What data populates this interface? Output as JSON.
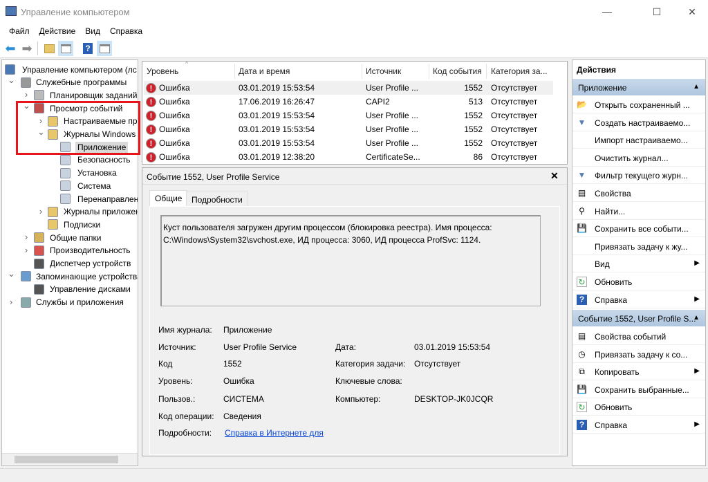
{
  "window": {
    "title": "Управление компьютером",
    "minimize": "—",
    "maximize": "☐",
    "close": "✕"
  },
  "menu": [
    "Файл",
    "Действие",
    "Вид",
    "Справка"
  ],
  "colors": {
    "accent": "#0078d7",
    "highlight": "#e8141b",
    "error": "#d0202a",
    "section": "#b8cde2",
    "link": "#0645d6"
  },
  "tree": [
    {
      "label": "Управление компьютером (лс",
      "level": 0,
      "exp": "",
      "icon": "computer-icon",
      "color": "#4a78b5"
    },
    {
      "label": "Служебные программы",
      "level": 1,
      "exp": "v",
      "icon": "tools-icon",
      "color": "#999"
    },
    {
      "label": "Планировщик заданий",
      "level": 2,
      "exp": ">",
      "icon": "clock-icon",
      "color": "#bbb"
    },
    {
      "label": "Просмотр событий",
      "level": 2,
      "exp": "v",
      "icon": "event-viewer-icon",
      "color": "#c0504d"
    },
    {
      "label": "Настраиваемые пре",
      "level": 3,
      "exp": ">",
      "icon": "filter-folder-icon",
      "color": "#e8c76b"
    },
    {
      "label": "Журналы Windows",
      "level": 3,
      "exp": "v",
      "icon": "folder-icon",
      "color": "#e8c76b"
    },
    {
      "label": "Приложение",
      "level": 4,
      "exp": "",
      "icon": "log-icon",
      "color": "#c9d3e0",
      "selected": true
    },
    {
      "label": "Безопасность",
      "level": 4,
      "exp": "",
      "icon": "log-icon",
      "color": "#c9d3e0"
    },
    {
      "label": "Установка",
      "level": 4,
      "exp": "",
      "icon": "log-icon",
      "color": "#c9d3e0"
    },
    {
      "label": "Система",
      "level": 4,
      "exp": "",
      "icon": "log-icon",
      "color": "#c9d3e0"
    },
    {
      "label": "Перенаправлен",
      "level": 4,
      "exp": "",
      "icon": "log-icon",
      "color": "#c9d3e0"
    },
    {
      "label": "Журналы приложен",
      "level": 3,
      "exp": ">",
      "icon": "folder-icon",
      "color": "#e8c76b"
    },
    {
      "label": "Подписки",
      "level": 3,
      "exp": "",
      "icon": "subscriptions-icon",
      "color": "#e8c76b"
    },
    {
      "label": "Общие папки",
      "level": 2,
      "exp": ">",
      "icon": "shared-folder-icon",
      "color": "#d6b35a"
    },
    {
      "label": "Производительность",
      "level": 2,
      "exp": ">",
      "icon": "performance-icon",
      "color": "#d9534f"
    },
    {
      "label": "Диспетчер устройств",
      "level": 2,
      "exp": "",
      "icon": "device-manager-icon",
      "color": "#555"
    },
    {
      "label": "Запоминающие устройства",
      "level": 1,
      "exp": "v",
      "icon": "storage-icon",
      "color": "#6a9ccf"
    },
    {
      "label": "Управление дисками",
      "level": 2,
      "exp": "",
      "icon": "disk-icon",
      "color": "#555"
    },
    {
      "label": "Службы и приложения",
      "level": 1,
      "exp": ">",
      "icon": "services-icon",
      "color": "#8aa"
    }
  ],
  "events": {
    "columns": [
      "Уровень",
      "Дата и время",
      "Источник",
      "Код события",
      "Категория за..."
    ],
    "rows": [
      [
        "Ошибка",
        "03.01.2019 15:53:54",
        "User Profile ...",
        "1552",
        "Отсутствует"
      ],
      [
        "Ошибка",
        "17.06.2019 16:26:47",
        "CAPI2",
        "513",
        "Отсутствует"
      ],
      [
        "Ошибка",
        "03.01.2019 15:53:54",
        "User Profile ...",
        "1552",
        "Отсутствует"
      ],
      [
        "Ошибка",
        "03.01.2019 15:53:54",
        "User Profile ...",
        "1552",
        "Отсутствует"
      ],
      [
        "Ошибка",
        "03.01.2019 15:53:54",
        "User Profile ...",
        "1552",
        "Отсутствует"
      ],
      [
        "Ошибка",
        "03.01.2019 12:38:20",
        "CertificateSe...",
        "86",
        "Отсутствует"
      ]
    ]
  },
  "detail": {
    "title": "Событие 1552, User Profile Service",
    "tabs": [
      "Общие",
      "Подробности"
    ],
    "description": "Куст пользователя загружен другим процессом (блокировка реестра). Имя процесса: C:\\Windows\\System32\\svchost.exe, ИД процесса: 3060, ИД процесса ProfSvc: 1124.",
    "fields": {
      "log_label": "Имя журнала:",
      "log": "Приложение",
      "source_label": "Источник:",
      "source": "User Profile Service",
      "date_label": "Дата:",
      "date": "03.01.2019 15:53:54",
      "code_label": "Код",
      "code": "1552",
      "category_label": "Категория задачи:",
      "category": "Отсутствует",
      "level_label": "Уровень:",
      "level": "Ошибка",
      "keywords_label": "Ключевые слова:",
      "user_label": "Пользов.:",
      "user": "СИСТЕМА",
      "computer_label": "Компьютер:",
      "computer": "DESKTOP-JK0JCQR",
      "opcode_label": "Код операции:",
      "opcode": "Сведения",
      "more_label": "Подробности:",
      "more_link": "Справка в Интернете для"
    }
  },
  "actions": {
    "title": "Действия",
    "section1": "Приложение",
    "items1": [
      {
        "label": "Открыть сохраненный ...",
        "icon": "open-folder-icon",
        "glyph": "📂"
      },
      {
        "label": "Создать настраиваемо...",
        "icon": "filter-icon",
        "glyph": "▼"
      },
      {
        "label": "Импорт настраиваемо...",
        "icon": "",
        "glyph": ""
      },
      {
        "label": "Очистить журнал...",
        "icon": "",
        "glyph": ""
      },
      {
        "label": "Фильтр текущего журн...",
        "icon": "filter-icon",
        "glyph": "▼"
      },
      {
        "label": "Свойства",
        "icon": "properties-icon",
        "glyph": "▤"
      },
      {
        "label": "Найти...",
        "icon": "binoculars-icon",
        "glyph": "⚲"
      },
      {
        "label": "Сохранить все событи...",
        "icon": "save-icon",
        "glyph": "💾"
      },
      {
        "label": "Привязать задачу к жу...",
        "icon": "",
        "glyph": ""
      },
      {
        "label": "Вид",
        "icon": "",
        "glyph": "",
        "sub": "▶"
      },
      {
        "label": "Обновить",
        "icon": "refresh-icon",
        "glyph": "↻"
      },
      {
        "label": "Справка",
        "icon": "help-icon",
        "glyph": "?",
        "sub": "▶"
      }
    ],
    "section2": "Событие 1552, User Profile S...",
    "items2": [
      {
        "label": "Свойства событий",
        "icon": "properties-icon",
        "glyph": "▤"
      },
      {
        "label": "Привязать задачу к со...",
        "icon": "task-icon",
        "glyph": "◷"
      },
      {
        "label": "Копировать",
        "icon": "copy-icon",
        "glyph": "⧉",
        "sub": "▶"
      },
      {
        "label": "Сохранить выбранные...",
        "icon": "save-icon",
        "glyph": "💾"
      },
      {
        "label": "Обновить",
        "icon": "refresh-icon",
        "glyph": "↻"
      },
      {
        "label": "Справка",
        "icon": "help-icon",
        "glyph": "?",
        "sub": "▶"
      }
    ]
  }
}
